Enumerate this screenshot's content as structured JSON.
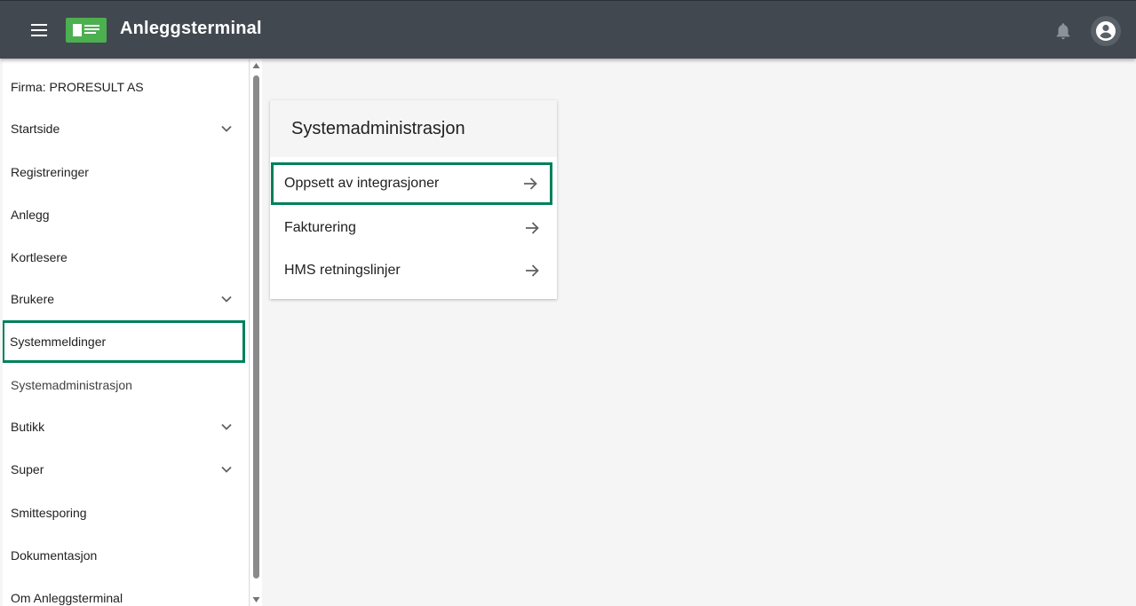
{
  "header": {
    "title": "Anleggsterminal",
    "menu_icon": "hamburger-menu-icon",
    "logo_icon": "terminal-logo-icon",
    "notifications_icon": "bell-icon",
    "account_icon": "account-circle-icon"
  },
  "sidebar": {
    "firma": "Firma: PRORESULT AS",
    "items": [
      {
        "label": "Startside",
        "expandable": true
      },
      {
        "label": "Registreringer",
        "expandable": false
      },
      {
        "label": "Anlegg",
        "expandable": false
      },
      {
        "label": "Kortlesere",
        "expandable": false
      },
      {
        "label": "Brukere",
        "expandable": true
      },
      {
        "label": "Systemmeldinger",
        "expandable": false
      },
      {
        "label": "Systemadministrasjon",
        "expandable": false
      },
      {
        "label": "Butikk",
        "expandable": true
      },
      {
        "label": "Super",
        "expandable": true
      },
      {
        "label": "Smittesporing",
        "expandable": false
      },
      {
        "label": "Dokumentasjon",
        "expandable": false
      },
      {
        "label": "Om Anleggsterminal",
        "expandable": false
      }
    ]
  },
  "card": {
    "title": "Systemadministrasjon",
    "items": [
      {
        "label": "Oppsett av integrasjoner"
      },
      {
        "label": "Fakturering"
      },
      {
        "label": "HMS retningslinjer"
      }
    ]
  },
  "colors": {
    "topbar": "#424850",
    "accent": "#00805a",
    "logo": "#4caf50"
  }
}
